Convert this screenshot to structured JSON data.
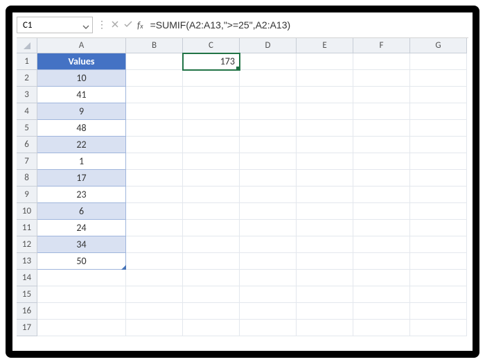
{
  "name_box": {
    "value": "C1"
  },
  "formula_bar": {
    "formula": "=SUMIF(A2:A13,\">=25\",A2:A13)"
  },
  "columns": [
    "A",
    "B",
    "C",
    "D",
    "E",
    "F",
    "G"
  ],
  "rows": [
    "1",
    "2",
    "3",
    "4",
    "5",
    "6",
    "7",
    "8",
    "9",
    "10",
    "11",
    "12",
    "13",
    "14",
    "15",
    "16",
    "17"
  ],
  "table": {
    "header": "Values",
    "data": [
      "10",
      "41",
      "9",
      "48",
      "22",
      "1",
      "17",
      "23",
      "6",
      "24",
      "34",
      "50"
    ]
  },
  "result_cell": {
    "value": "173"
  },
  "chart_data": {
    "type": "table",
    "title": "Values",
    "categories": [
      "Row2",
      "Row3",
      "Row4",
      "Row5",
      "Row6",
      "Row7",
      "Row8",
      "Row9",
      "Row10",
      "Row11",
      "Row12",
      "Row13"
    ],
    "values": [
      10,
      41,
      9,
      48,
      22,
      1,
      17,
      23,
      6,
      24,
      34,
      50
    ],
    "computed": {
      "cell": "C1",
      "label": "SUMIF >=25",
      "value": 173
    }
  }
}
